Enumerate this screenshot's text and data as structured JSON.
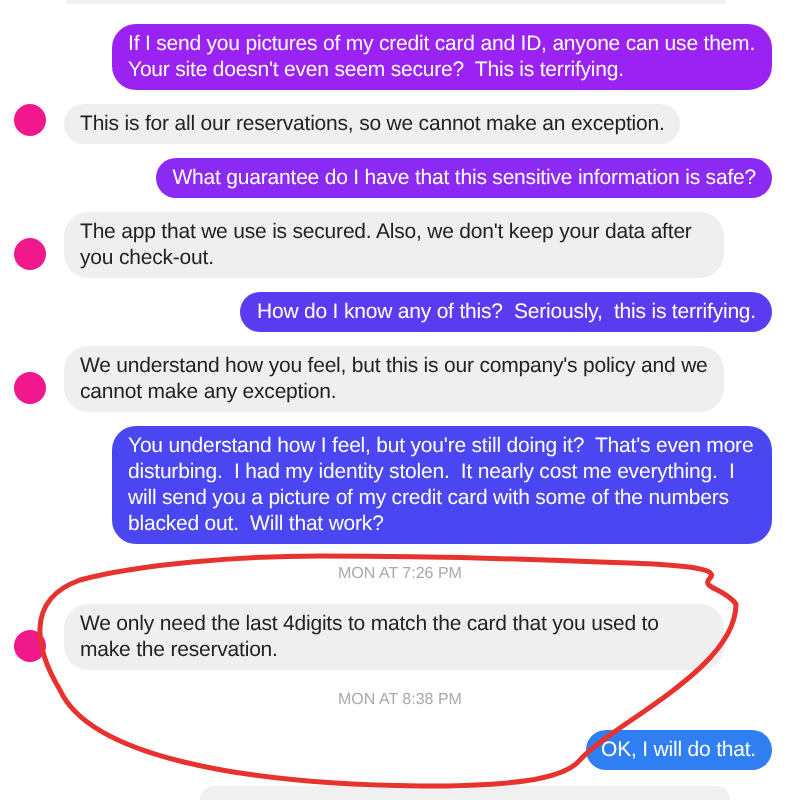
{
  "messages": [
    {
      "kind": "sent",
      "text": "If I send you pictures of my credit card and ID, anyone can use them. Your site doesn't even seem secure?  This is terrifying.",
      "color": "#9a22f2"
    },
    {
      "kind": "received",
      "text": "This is for all our reservations, so we cannot make an exception."
    },
    {
      "kind": "sent",
      "text": "What guarantee do I have that this sensitive information is safe?",
      "color": "#8a2af2"
    },
    {
      "kind": "received",
      "text": "The app that we use is secured. Also, we don't keep your data after you check-out."
    },
    {
      "kind": "sent",
      "text": "How do I know any of this?  Seriously,  this is terrifying.",
      "color": "#5b3bf0"
    },
    {
      "kind": "received",
      "text": "We understand how you feel, but this is our company's policy and we cannot make any exception."
    },
    {
      "kind": "sent",
      "text": "You understand how I feel, but you're still doing it?  That's even more disturbing.  I had my identity stolen.  It nearly cost me everything.  I will send you a picture of my credit card with some of the numbers blacked out.  Will that work?",
      "color": "#4a46f2"
    },
    {
      "kind": "timestamp",
      "text": "MON AT 7:26 PM"
    },
    {
      "kind": "received",
      "text": "We only need the last 4digits to match the card that you used to make the reservation."
    },
    {
      "kind": "timestamp",
      "text": "MON AT 8:38 PM"
    },
    {
      "kind": "sent",
      "text": "OK, I will do that.",
      "color": "#2f7ff2"
    }
  ]
}
